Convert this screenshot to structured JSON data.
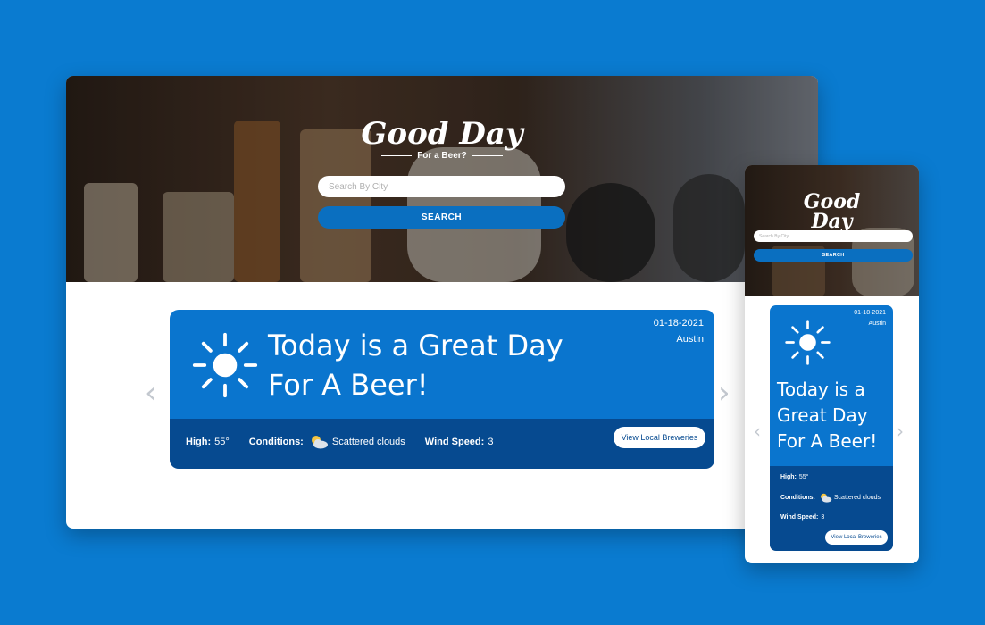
{
  "brand": {
    "name": "Good Day",
    "tagline": "For a Beer?"
  },
  "search": {
    "placeholder": "Search By City",
    "button_label": "SEARCH"
  },
  "weather": {
    "date": "01-18-2021",
    "city": "Austin",
    "headline": "Today is a Great Day For A Beer!",
    "high_label": "High:",
    "high_value": "55°",
    "conditions_label": "Conditions:",
    "conditions_value": "Scattered clouds",
    "wind_label": "Wind Speed:",
    "wind_value": "3",
    "cta_label": "View Local Breweries",
    "icon": "sun-icon",
    "conditions_icon": "partly-cloudy-icon"
  },
  "nav": {
    "prev_glyph": "‹",
    "next_glyph": "›"
  },
  "colors": {
    "background": "#0a7bd0",
    "card_top": "#0a75ce",
    "card_bottom": "#064a90",
    "button": "#0a6fc0",
    "chevron": "#c3c8cf"
  }
}
